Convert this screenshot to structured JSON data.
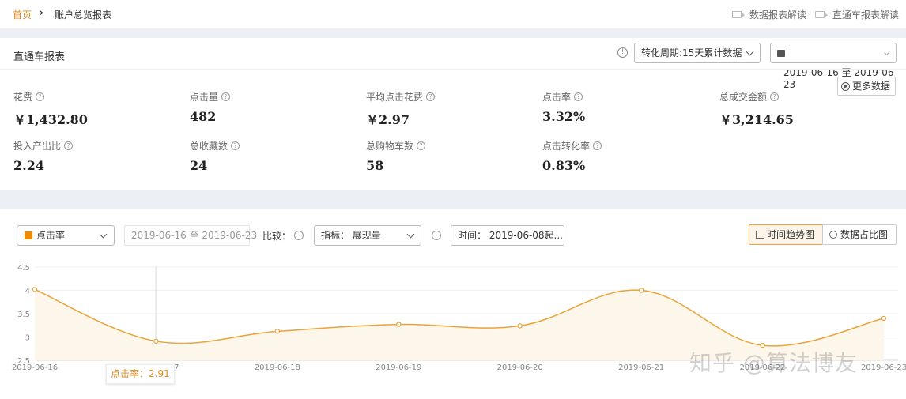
{
  "breadcrumb": {
    "home": "首页",
    "current": "账户总览报表"
  },
  "top_links": [
    {
      "label": "数据报表解读"
    },
    {
      "label": "直通车报表解读"
    }
  ],
  "report": {
    "title": "直通车报表",
    "period_select": "转化周期:15天累计数据",
    "date_select": "",
    "date_range": "2019-06-16 至 2019-06-23",
    "more_button": "更多数据",
    "metrics": [
      {
        "label": "花费",
        "value": "￥1,432.80"
      },
      {
        "label": "点击量",
        "value": "482"
      },
      {
        "label": "平均点击花费",
        "value": "￥2.97"
      },
      {
        "label": "点击率",
        "value": "3.32%"
      },
      {
        "label": "总成交金额",
        "value": "￥3,214.65"
      },
      {
        "label": "投入产出比",
        "value": "2.24"
      },
      {
        "label": "总收藏数",
        "value": "24"
      },
      {
        "label": "总购物车数",
        "value": "58"
      },
      {
        "label": "点击转化率",
        "value": "0.83%"
      }
    ]
  },
  "chart_controls": {
    "metric_select": "点击率",
    "date_range": "2019-06-16 至 2019-06-23",
    "compare_label": "比较：",
    "indicator_select": "指标：  展现量",
    "time_select": "时间：  2019-06-08起...",
    "trend_button": "时间趋势图",
    "share_button": "数据占比图"
  },
  "colors": {
    "accent": "#e08a1e",
    "line": "#e8a43a",
    "area": "#fdf6ea",
    "band": "#eceff4"
  },
  "chart_data": {
    "type": "area",
    "title": "",
    "xlabel": "",
    "ylabel": "",
    "x_labels": [
      "2019-06-16",
      "2019-06-17",
      "2019-06-18",
      "2019-06-19",
      "2019-06-20",
      "2019-06-21",
      "2019-06-22",
      "2019-06-23"
    ],
    "y_ticks": [
      "2.5",
      "3",
      "3.5",
      "4",
      "4.5"
    ],
    "ylim": [
      2.5,
      4.5
    ],
    "grid": true,
    "series": [
      {
        "name": "点击率",
        "values": [
          4.02,
          2.91,
          3.12,
          3.27,
          3.24,
          4.0,
          2.82,
          3.4
        ]
      }
    ],
    "tooltip": "点击率：2.91"
  },
  "watermark": "知乎 @算法博友"
}
